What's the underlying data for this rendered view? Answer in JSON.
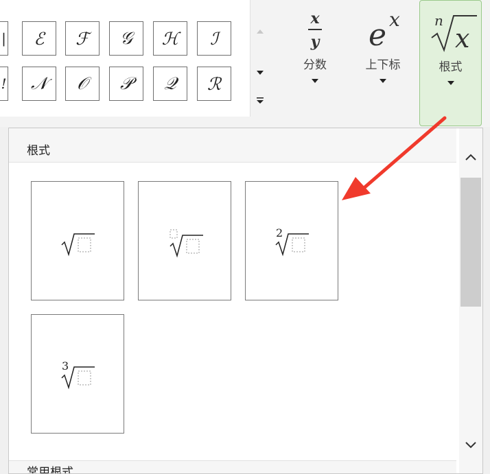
{
  "symbols": {
    "row1": [
      "ℰ",
      "ℱ",
      "𝒢",
      "ℋ",
      "ℐ"
    ],
    "row2": [
      "𝒩",
      "𝒪",
      "𝒫",
      "𝒬",
      "ℛ"
    ],
    "partial_row1": "|",
    "partial_row2": "!"
  },
  "ribbon": {
    "fraction": {
      "numerator": "x",
      "denominator": "y",
      "label": "分数"
    },
    "script": {
      "base": "e",
      "sup": "x",
      "label": "上下标"
    },
    "radical": {
      "index": "n",
      "radicand": "x",
      "label": "根式"
    },
    "icons": {
      "scroll_up": "triangle-up",
      "scroll_down": "triangle-down",
      "more": "more-arrow",
      "dropdown": "triangle-down"
    }
  },
  "dropdown": {
    "section_title": "根式",
    "footer_title": "常用根式",
    "templates": [
      {
        "id": "square-root",
        "index": ""
      },
      {
        "id": "nth-root",
        "index": "□"
      },
      {
        "id": "square-root-with-degree",
        "index": "2"
      },
      {
        "id": "cube-root",
        "index": "3"
      }
    ]
  },
  "colors": {
    "selected_fill": "#e2f1dc",
    "selected_border": "#99c98a",
    "annotation_arrow": "#f03a2c"
  }
}
